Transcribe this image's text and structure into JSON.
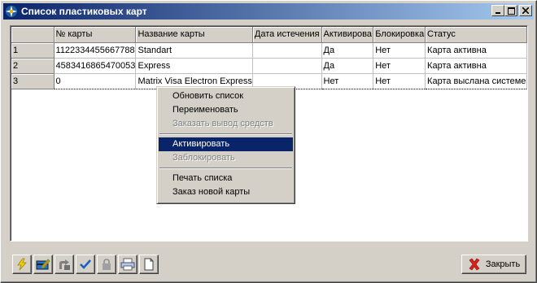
{
  "window": {
    "title": "Список пластиковых карт"
  },
  "grid": {
    "columns": [
      "",
      "№ карты",
      "Название карты",
      "Дата истечения",
      "Активирова",
      "Блокировка",
      "Статус"
    ],
    "rows": [
      [
        "1",
        "1122334455667788",
        "Standart",
        "",
        "Да",
        "Нет",
        "Карта активна"
      ],
      [
        "2",
        "4583416865470053",
        "Express",
        "",
        "Да",
        "Нет",
        "Карта активна"
      ],
      [
        "3",
        "0",
        "Matrix Visa Electron Express",
        "",
        "Нет",
        "Нет",
        "Карта выслана системе"
      ]
    ],
    "selected_row": 3
  },
  "context_menu": {
    "items": [
      {
        "label": "Обновить список",
        "enabled": true
      },
      {
        "label": "Переименовать",
        "enabled": true
      },
      {
        "label": "Заказать вывод средств",
        "enabled": false
      },
      {
        "separator": true
      },
      {
        "label": "Активировать",
        "enabled": true,
        "highlighted": true
      },
      {
        "label": "Заблокировать",
        "enabled": false
      },
      {
        "separator": true
      },
      {
        "label": "Печать списка",
        "enabled": true
      },
      {
        "label": "Заказ новой карты",
        "enabled": true
      }
    ]
  },
  "toolbar": {
    "icons": [
      "lightning-icon",
      "edit-card-icon",
      "transfer-icon",
      "checkmark-icon",
      "lock-icon",
      "printer-icon",
      "new-document-icon"
    ]
  },
  "close_button": {
    "label": "Закрыть"
  },
  "colors": {
    "title_start": "#0a246a",
    "title_end": "#a6caf0",
    "menu_highlight": "#0a246a",
    "face": "#d4d0c8"
  }
}
